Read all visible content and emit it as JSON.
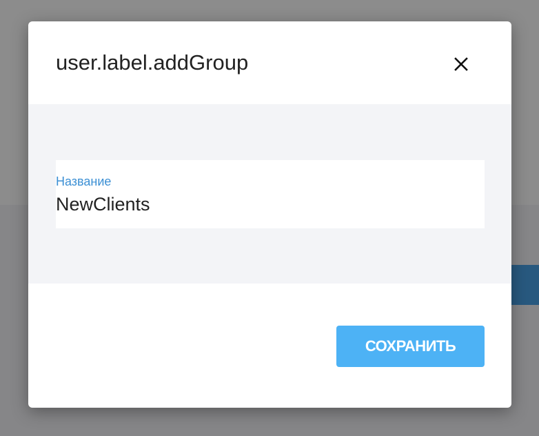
{
  "dialog": {
    "title": "user.label.addGroup",
    "close_icon": "close-icon",
    "field": {
      "label": "Название",
      "value": "NewClients"
    },
    "save_label": "СОХРАНИТЬ"
  },
  "colors": {
    "accent": "#4db2f5",
    "label": "#3b8fd4",
    "body_bg": "#f3f4f7"
  }
}
